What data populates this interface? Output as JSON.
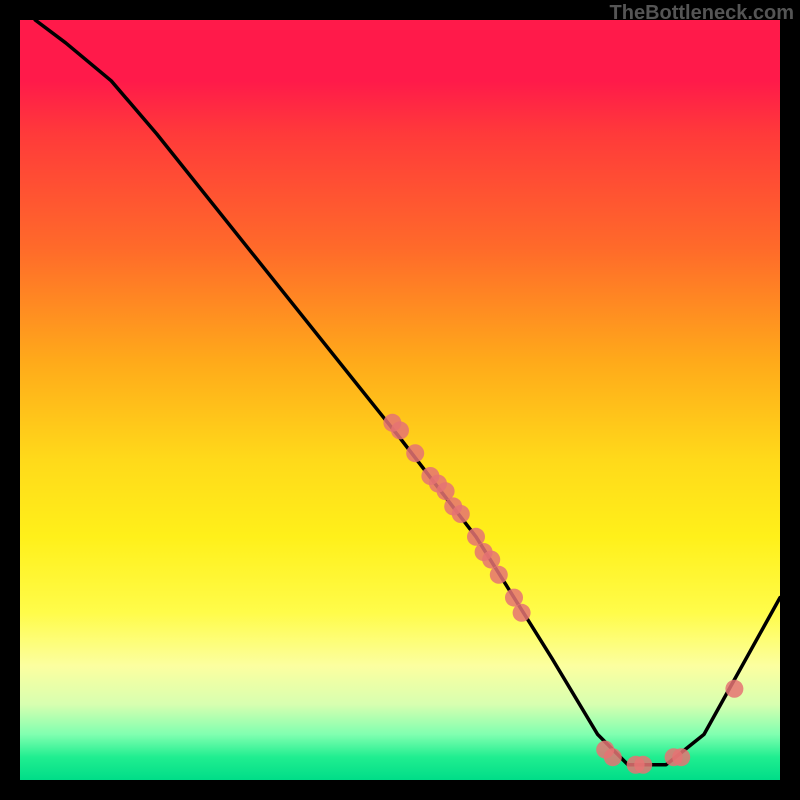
{
  "attribution": "TheBottleneck.com",
  "chart_data": {
    "type": "line",
    "title": "",
    "xlabel": "",
    "ylabel": "",
    "xlim": [
      0,
      100
    ],
    "ylim": [
      0,
      100
    ],
    "curve": [
      {
        "x": 2,
        "y": 100
      },
      {
        "x": 6,
        "y": 97
      },
      {
        "x": 12,
        "y": 92
      },
      {
        "x": 18,
        "y": 85
      },
      {
        "x": 50,
        "y": 45
      },
      {
        "x": 60,
        "y": 32
      },
      {
        "x": 70,
        "y": 16
      },
      {
        "x": 76,
        "y": 6
      },
      {
        "x": 80,
        "y": 2
      },
      {
        "x": 85,
        "y": 2
      },
      {
        "x": 90,
        "y": 6
      },
      {
        "x": 100,
        "y": 24
      }
    ],
    "dot_clusters": [
      {
        "x": 49,
        "y": 47
      },
      {
        "x": 50,
        "y": 46
      },
      {
        "x": 52,
        "y": 43
      },
      {
        "x": 54,
        "y": 40
      },
      {
        "x": 55,
        "y": 39
      },
      {
        "x": 56,
        "y": 38
      },
      {
        "x": 57,
        "y": 36
      },
      {
        "x": 58,
        "y": 35
      },
      {
        "x": 60,
        "y": 32
      },
      {
        "x": 61,
        "y": 30
      },
      {
        "x": 62,
        "y": 29
      },
      {
        "x": 63,
        "y": 27
      },
      {
        "x": 65,
        "y": 24
      },
      {
        "x": 66,
        "y": 22
      },
      {
        "x": 77,
        "y": 4
      },
      {
        "x": 78,
        "y": 3
      },
      {
        "x": 81,
        "y": 2
      },
      {
        "x": 82,
        "y": 2
      },
      {
        "x": 86,
        "y": 3
      },
      {
        "x": 87,
        "y": 3
      },
      {
        "x": 94,
        "y": 12
      }
    ],
    "dot_color": "#e57373",
    "line_color": "#000000"
  }
}
